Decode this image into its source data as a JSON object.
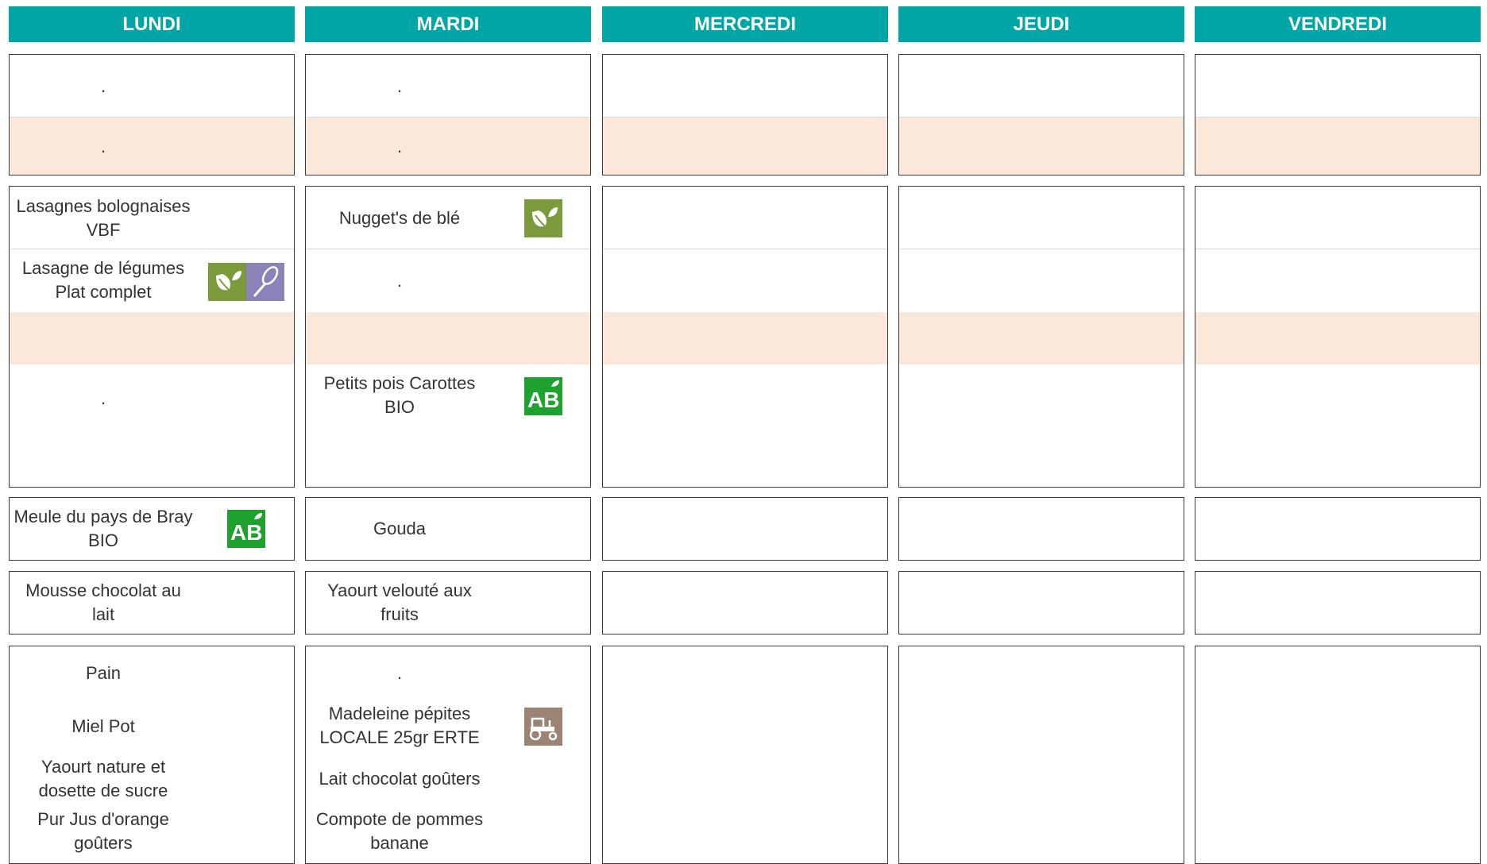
{
  "days": [
    "LUNDI",
    "MARDI",
    "MERCREDI",
    "JEUDI",
    "VENDREDI"
  ],
  "lundi": {
    "entree_1": ".",
    "entree_2": ".",
    "plat_1": [
      "Lasagnes bolognaises",
      "VBF"
    ],
    "plat_2": [
      "Lasagne de légumes",
      "Plat complet"
    ],
    "accompagnement": ".",
    "fromage": [
      "Meule du pays de Bray",
      "BIO"
    ],
    "dessert": [
      "Mousse chocolat au",
      "lait"
    ],
    "gouter": {
      "item_1": "Pain",
      "item_2": "Miel Pot",
      "item_3": [
        "Yaourt nature et",
        "dosette de sucre"
      ],
      "item_4": [
        "Pur Jus d'orange",
        "goûters"
      ]
    }
  },
  "mardi": {
    "entree_1": ".",
    "entree_2": ".",
    "plat_1": "Nugget's de blé",
    "plat_2": ".",
    "accompagnement": [
      "Petits pois Carottes",
      "BIO"
    ],
    "fromage": "Gouda",
    "dessert": [
      "Yaourt velouté aux",
      "fruits"
    ],
    "gouter": {
      "item_1": ".",
      "item_2": [
        "Madeleine pépites",
        "LOCALE 25gr ERTE"
      ],
      "item_3": "Lait chocolat goûters",
      "item_4": [
        "Compote de pommes",
        "banane"
      ]
    }
  },
  "badges": {
    "vegetarien": "leaf-icon",
    "fait_maison": "whisk-icon",
    "bio": "ab-bio-icon",
    "local": "tractor-icon"
  },
  "colors": {
    "header": "#00a6a6",
    "peach_band": "#fbe8da",
    "vegetarien": "#7a9a3c",
    "fait_maison": "#8a82b8",
    "bio": "#1ea12e",
    "local": "#9b8474"
  }
}
